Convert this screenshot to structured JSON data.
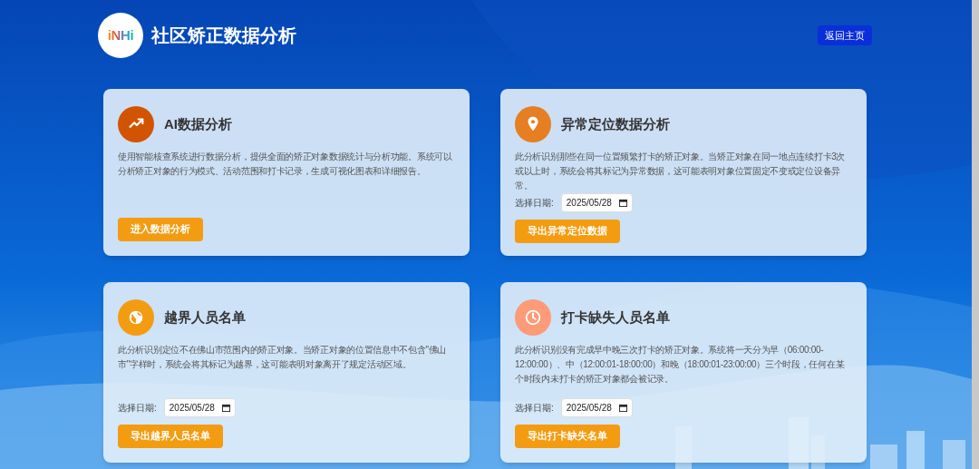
{
  "header": {
    "logo_text": "iNHi",
    "title": "社区矫正数据分析",
    "home_button": "返回主页"
  },
  "cards": [
    {
      "kind": "trend",
      "color": "#d35400",
      "title": "AI数据分析",
      "description": "使用智能核查系统进行数据分析，提供全面的矫正对象数据统计与分析功能。系统可以分析矫正对象的行为模式、活动范围和打卡记录，生成可视化图表和详细报告。",
      "button": "进入数据分析"
    },
    {
      "kind": "pin",
      "color": "#e67e22",
      "title": "异常定位数据分析",
      "description": "此分析识别那些在同一位置频繁打卡的矫正对象。当矫正对象在同一地点连续打卡3次或以上时，系统会将其标记为异常数据，这可能表明对象位置固定不变或定位设备异常。",
      "date_label": "选择日期:",
      "date_value": "2025/05/28",
      "button": "导出异常定位数据"
    },
    {
      "kind": "globe",
      "color": "#f39c12",
      "title": "越界人员名单",
      "description": "此分析识别定位不在佛山市范围内的矫正对象。当矫正对象的位置信息中不包含\"佛山市\"字样时，系统会将其标记为越界，这可能表明对象离开了规定活动区域。",
      "date_label": "选择日期:",
      "date_value": "2025/05/28",
      "button": "导出越界人员名单"
    },
    {
      "kind": "clock",
      "color": "#fd9a78",
      "title": "打卡缺失人员名单",
      "description": "此分析识别没有完成早中晚三次打卡的矫正对象。系统将一天分为早（06:00:00-12:00:00）、中（12:00:01-18:00:00）和晚（18:00:01-23:00:00）三个时段，任何在某个时段内未打卡的矫正对象都会被记录。",
      "date_label": "选择日期:",
      "date_value": "2025/05/28",
      "button": "导出打卡缺失名单"
    }
  ]
}
